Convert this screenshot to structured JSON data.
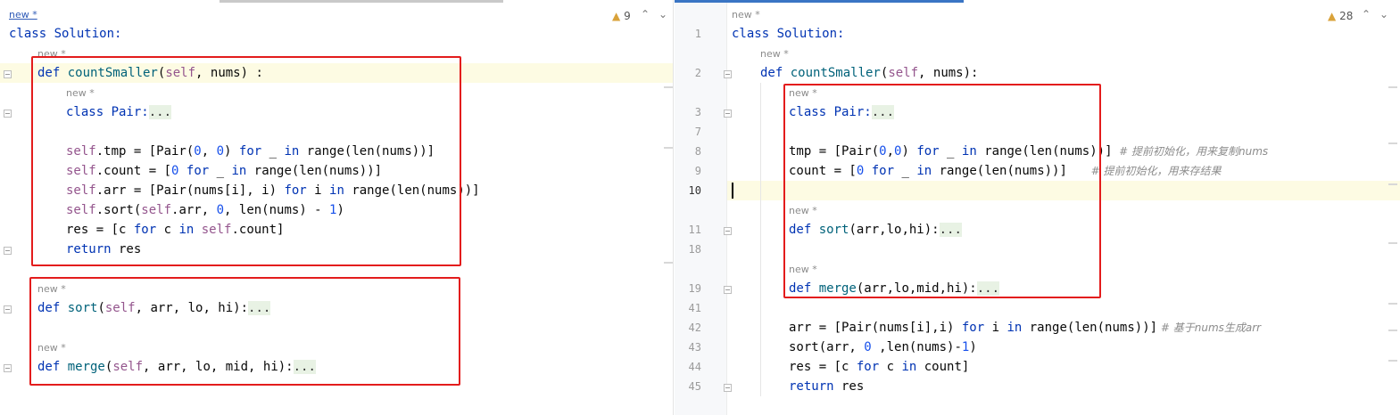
{
  "left": {
    "badge": "9",
    "hints": [
      "new *",
      "new *",
      "new *",
      "new *",
      "new *"
    ],
    "lines": {
      "l1": [
        "class Solution:"
      ],
      "l2": [
        "def ",
        "countSmaller",
        "(",
        "self",
        ", nums)",
        ":"
      ],
      "l3": [
        "class Pair:",
        "..."
      ],
      "l4": [
        "self",
        ".tmp = [Pair(",
        "0",
        ", ",
        "0",
        ") ",
        "for",
        " _ ",
        "in",
        " range(len(nums))]"
      ],
      "l5": [
        "self",
        ".count = [",
        "0",
        " ",
        "for",
        " _ ",
        "in",
        " range(len(nums))]"
      ],
      "l6": [
        "self",
        ".arr = [Pair(nums[i], i) ",
        "for",
        " i ",
        "in",
        " range(len(nums))]"
      ],
      "l7": [
        "self",
        ".sort(",
        "self",
        ".arr, ",
        "0",
        ", len(nums) - ",
        "1",
        ")"
      ],
      "l8": [
        "res = [c ",
        "for",
        " c ",
        "in",
        " ",
        "self",
        ".count]"
      ],
      "l9": [
        "return",
        " res"
      ],
      "l10": [
        "def ",
        "sort",
        "(",
        "self",
        ", arr, lo, hi):",
        "..."
      ],
      "l11": [
        "def ",
        "merge",
        "(",
        "self",
        ", arr, lo, mid, hi):",
        "..."
      ]
    }
  },
  "right": {
    "badge": "28",
    "hints": [
      "new *",
      "new *",
      "new *",
      "new *",
      "new *"
    ],
    "line_numbers": [
      "1",
      "2",
      "3",
      "7",
      "8",
      "9",
      "10",
      "11",
      "18",
      "19",
      "41",
      "42",
      "43",
      "44",
      "45"
    ],
    "lines": {
      "r1": [
        "class Solution:"
      ],
      "r2": [
        "def ",
        "countSmaller",
        "(",
        "self",
        ", nums):"
      ],
      "r3": [
        "class Pair:",
        "..."
      ],
      "r4": [
        "tmp = [Pair(",
        "0",
        ",",
        "0",
        ") ",
        "for",
        " _ ",
        "in",
        " range(len(nums))]",
        "  # 提前初始化，用来复制nums"
      ],
      "r5": [
        "count = [",
        "0",
        " ",
        "for",
        " _ ",
        "in",
        " range(len(nums))]",
        "       # 提前初始化，用来存结果"
      ],
      "r6": [
        "def ",
        "sort",
        "(arr,lo,hi):",
        "..."
      ],
      "r7": [
        "def ",
        "merge",
        "(arr,lo,mid,hi):",
        "..."
      ],
      "r8": [
        "arr = [Pair(nums[i],i) ",
        "for",
        " i ",
        "in",
        " range(len(nums))]",
        " # 基于nums生成arr"
      ],
      "r9": [
        "sort(arr, ",
        "0",
        " ,len(nums)-",
        "1",
        ")"
      ],
      "r10": [
        "res = [c ",
        "for",
        " c ",
        "in",
        " count]"
      ],
      "r11": [
        "return",
        " res"
      ]
    }
  }
}
